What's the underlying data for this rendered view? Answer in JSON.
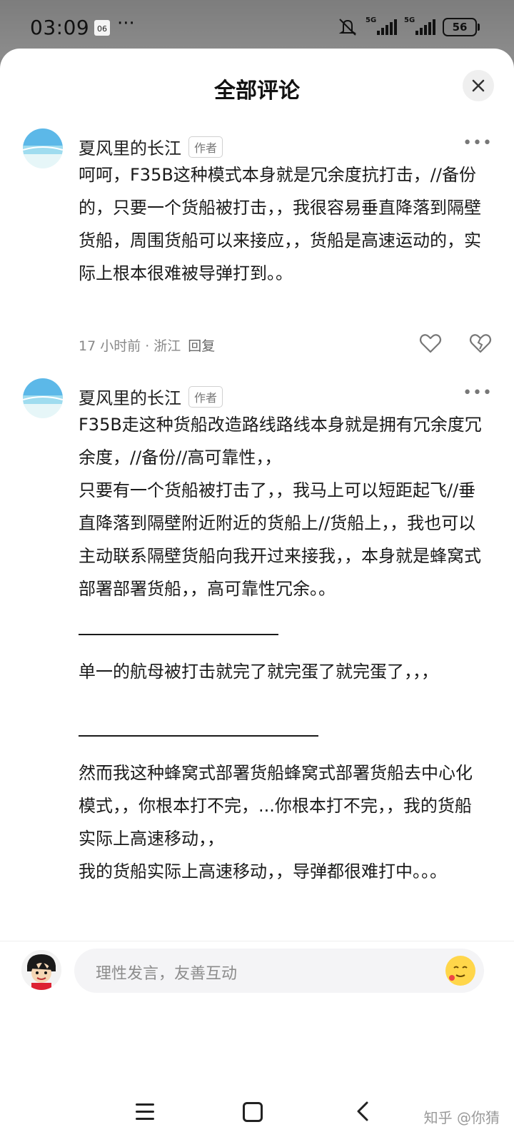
{
  "status_bar": {
    "time": "03:09",
    "calendar_day": "06",
    "more": "···",
    "network_1": "5G",
    "network_2": "5G",
    "battery": "56"
  },
  "sheet": {
    "title": "全部评论",
    "close_icon": "close-icon"
  },
  "comments": [
    {
      "author": "夏风里的长江",
      "badge": "作者",
      "text": "呵呵，F35B这种模式本身就是冗余度抗打击，//备份的，只要一个货船被打击，，我很容易垂直降落到隔壁货船，周围货船可以来接应，，货船是高速运动的，实际上根本很难被导弹打到。。",
      "time": "17 小时前",
      "separator": "·",
      "location": "浙江",
      "reply": "回复"
    },
    {
      "author": "夏风里的长江",
      "badge": "作者",
      "paragraph_1": "F35B走这种货船改造路线路线本身就是拥有冗余度冗余度，//备份//高可靠性，，\n只要有一个货船被打击了，，我马上可以短距起飞//垂直降落到隔壁附近附近的货船上//货船上，，我也可以主动联系隔壁货船向我开过来接我，，本身就是蜂窝式部署部署货船，，高可靠性冗余。。",
      "paragraph_2": "单一的航母被打击就完了就完蛋了就完蛋了，，，",
      "paragraph_3": "然而我这种蜂窝式部署货船蜂窝式部署货船去中心化模式，，你根本打不完，...你根本打不完，，我的货船实际上高速移动，，\n我的货船实际上高速移动，，导弹都很难打中。。。"
    }
  ],
  "input": {
    "placeholder": "理性发言，友善互动"
  },
  "watermark": "知乎 @你猜",
  "colors": {
    "status_bg": "#8a8a8a",
    "sheet_bg": "#ffffff",
    "text": "#1a1a1a",
    "muted": "#888888"
  }
}
